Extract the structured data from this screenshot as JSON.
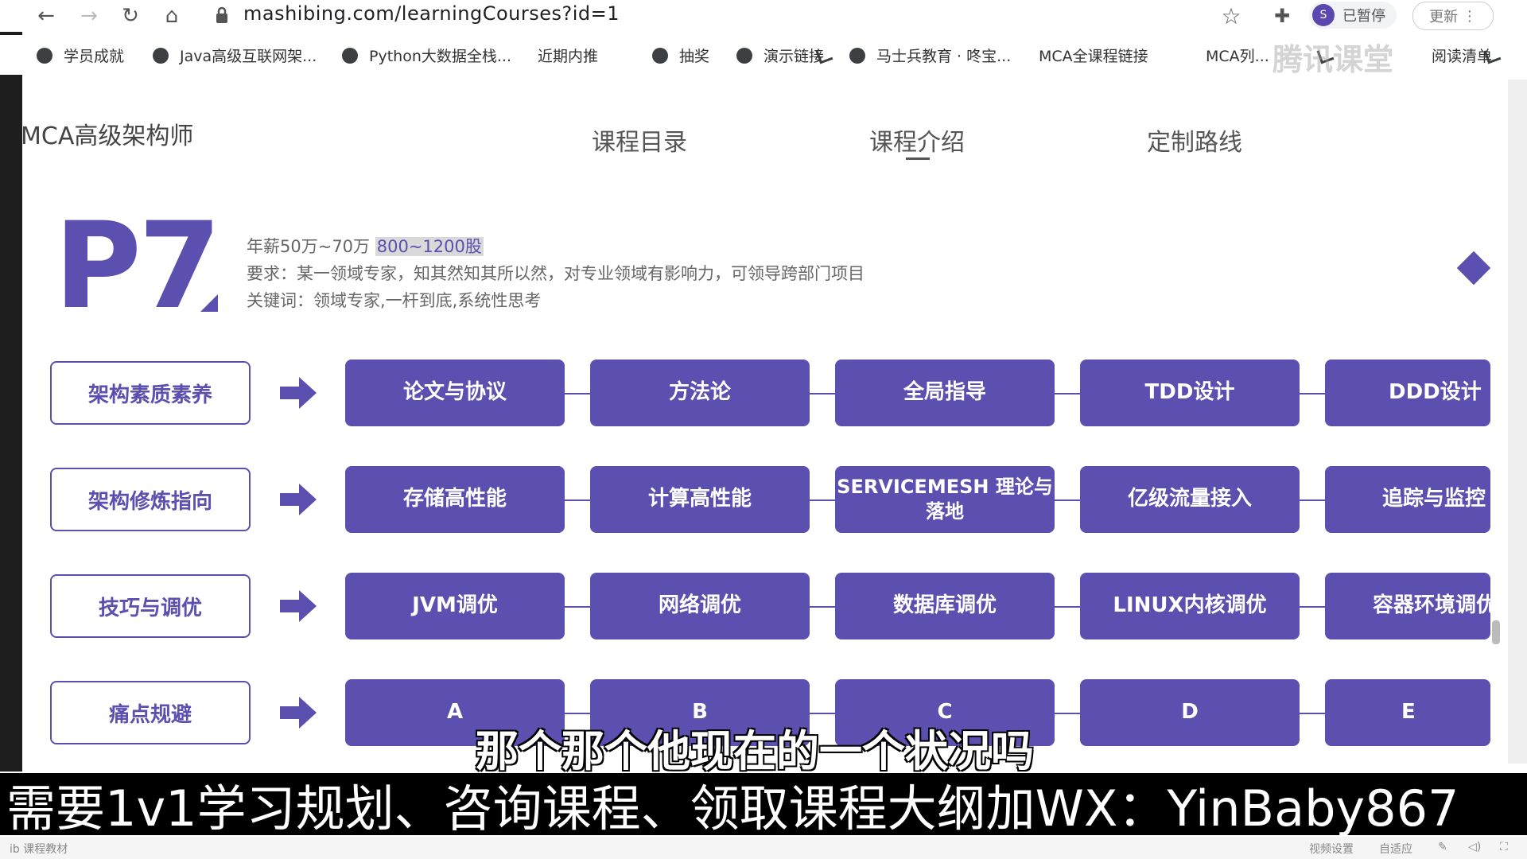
{
  "browser": {
    "url": "mashibing.com/learningCourses?id=1",
    "profile_label": "已暂停",
    "update_label": "更新",
    "bookmarks": [
      "学员成就",
      "Java高级互联网架...",
      "Python大数据全栈...",
      "近期内推",
      "抽奖",
      "演示链接",
      "马士兵教育 · 咚宝...",
      "MCA全课程链接",
      "MCA列..."
    ],
    "bookmarks_end": "阅读清单",
    "watermark": "腾讯课堂"
  },
  "header": {
    "brand": "MCA高级架构师",
    "tabs": [
      "课程目录",
      "课程介绍",
      "定制路线"
    ],
    "active_tab": "课程介绍"
  },
  "level": {
    "title": "P7",
    "salary_prefix": "年薪50万~70万",
    "salary_highlight": "800~1200股",
    "requirement": "要求：某一领域专家，知其然知其所以然，对专业领域有影响力，可领导跨部门项目",
    "keywords": "关键词：领域专家,一杆到底,系统性思考"
  },
  "rows": [
    {
      "category": "架构素质素养",
      "items": [
        "论文与协议",
        "方法论",
        "全局指导",
        "TDD设计",
        "DDD设计"
      ]
    },
    {
      "category": "架构修炼指向",
      "items": [
        "存储高性能",
        "计算高性能",
        "SERVICEMESH 理论与落地",
        "亿级流量接入",
        "追踪与监控"
      ]
    },
    {
      "category": "技巧与调优",
      "items": [
        "JVM调优",
        "网络调优",
        "数据库调优",
        "LINUX内核调优",
        "容器环境调优"
      ]
    },
    {
      "category": "痛点规避",
      "items": [
        "A",
        "B",
        "C",
        "D",
        "E"
      ]
    }
  ],
  "subtitle": "那个那个他现在的一个状况吗",
  "banner": "需要1v1学习规划、咨询课程、领取课程大纲加WX：YinBaby867",
  "statusbar": {
    "left": "ib 课程教材",
    "video_settings": "视频设置",
    "fit": "自适应"
  },
  "colors": {
    "accent": "#5b4fb0",
    "banner_bg": "#000000"
  }
}
